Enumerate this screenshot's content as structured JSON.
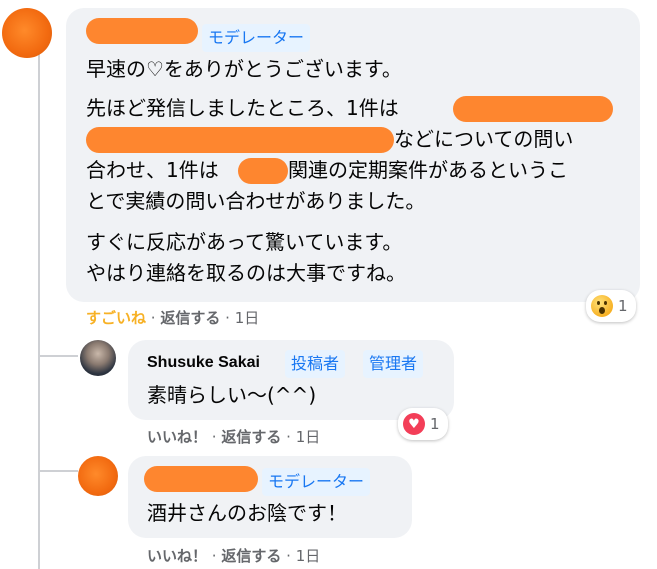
{
  "colors": {
    "accent": "#1877f2",
    "badge_bg": "#e7f3ff",
    "bubble_bg": "#f0f2f5",
    "redaction": "#ff7a1a",
    "reaction_active": "#f7b125",
    "love": "#f33e58"
  },
  "comments": [
    {
      "badges": [
        "モデレーター"
      ],
      "paragraphs": [
        "早速の♡をありがとうございます。",
        "先ほど発信しましたところ、1件は",
        "などについての問い",
        "合わせ、1件は",
        "関連の定期案件があるというこ",
        "とで実績の問い合わせがありました。",
        "すぐに反応があって驚いています。\nやはり連絡を取るのは大事ですね。"
      ],
      "actions": {
        "reaction": "すごいね",
        "sep1": "·",
        "reply": "返信する",
        "sep2": "·",
        "time": "1日"
      },
      "reaction_icon": "wow-emoji-icon",
      "reaction_count": "1"
    },
    {
      "author": "Shusuke Sakai",
      "badges": [
        "投稿者",
        "管理者"
      ],
      "text": "素晴らしい〜(^^)",
      "actions": {
        "reaction": "いいね！",
        "sep1": "·",
        "reply": "返信する",
        "sep2": "·",
        "time": "1日"
      },
      "reaction_icon": "love-emoji-icon",
      "reaction_count": "1"
    },
    {
      "badges": [
        "モデレーター"
      ],
      "text": "酒井さんのお陰です！",
      "actions": {
        "reaction": "いいね！",
        "sep1": "·",
        "reply": "返信する",
        "sep2": "·",
        "time": "1日"
      }
    }
  ]
}
